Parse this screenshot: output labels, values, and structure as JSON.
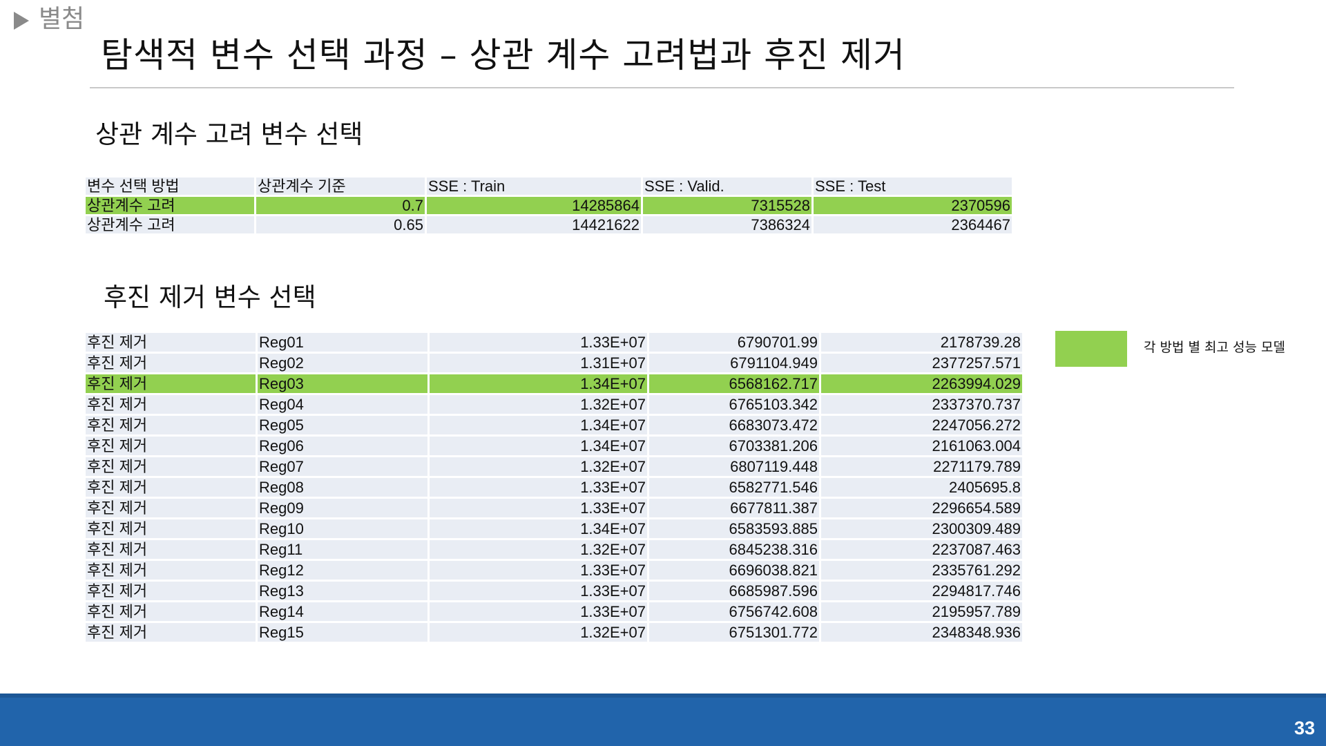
{
  "header": {
    "tag": "별첨",
    "title": "탐색적 변수 선택 과정 – 상관 계수 고려법과 후진 제거"
  },
  "section1": {
    "title": "상관 계수 고려 변수 선택",
    "columns": [
      "변수 선택 방법",
      "상관계수 기준",
      "SSE : Train",
      "SSE : Valid.",
      "SSE : Test"
    ],
    "rows": [
      {
        "method": "상관계수 고려",
        "threshold": "0.7",
        "train": "14285864",
        "valid": "7315528",
        "test": "2370596",
        "best": true
      },
      {
        "method": "상관계수 고려",
        "threshold": "0.65",
        "train": "14421622",
        "valid": "7386324",
        "test": "2364467",
        "best": false
      }
    ]
  },
  "section2": {
    "title": "후진 제거 변수 선택",
    "rows": [
      {
        "method": "후진 제거",
        "model": "Reg01",
        "train": "1.33E+07",
        "valid": "6790701.99",
        "test": "2178739.28",
        "best": false
      },
      {
        "method": "후진 제거",
        "model": "Reg02",
        "train": "1.31E+07",
        "valid": "6791104.949",
        "test": "2377257.571",
        "best": false
      },
      {
        "method": "후진 제거",
        "model": "Reg03",
        "train": "1.34E+07",
        "valid": "6568162.717",
        "test": "2263994.029",
        "best": true
      },
      {
        "method": "후진 제거",
        "model": "Reg04",
        "train": "1.32E+07",
        "valid": "6765103.342",
        "test": "2337370.737",
        "best": false
      },
      {
        "method": "후진 제거",
        "model": "Reg05",
        "train": "1.34E+07",
        "valid": "6683073.472",
        "test": "2247056.272",
        "best": false
      },
      {
        "method": "후진 제거",
        "model": "Reg06",
        "train": "1.34E+07",
        "valid": "6703381.206",
        "test": "2161063.004",
        "best": false
      },
      {
        "method": "후진 제거",
        "model": "Reg07",
        "train": "1.32E+07",
        "valid": "6807119.448",
        "test": "2271179.789",
        "best": false
      },
      {
        "method": "후진 제거",
        "model": "Reg08",
        "train": "1.33E+07",
        "valid": "6582771.546",
        "test": "2405695.8",
        "best": false
      },
      {
        "method": "후진 제거",
        "model": "Reg09",
        "train": "1.33E+07",
        "valid": "6677811.387",
        "test": "2296654.589",
        "best": false
      },
      {
        "method": "후진 제거",
        "model": "Reg10",
        "train": "1.34E+07",
        "valid": "6583593.885",
        "test": "2300309.489",
        "best": false
      },
      {
        "method": "후진 제거",
        "model": "Reg11",
        "train": "1.32E+07",
        "valid": "6845238.316",
        "test": "2237087.463",
        "best": false
      },
      {
        "method": "후진 제거",
        "model": "Reg12",
        "train": "1.33E+07",
        "valid": "6696038.821",
        "test": "2335761.292",
        "best": false
      },
      {
        "method": "후진 제거",
        "model": "Reg13",
        "train": "1.33E+07",
        "valid": "6685987.596",
        "test": "2294817.746",
        "best": false
      },
      {
        "method": "후진 제거",
        "model": "Reg14",
        "train": "1.33E+07",
        "valid": "6756742.608",
        "test": "2195957.789",
        "best": false
      },
      {
        "method": "후진 제거",
        "model": "Reg15",
        "train": "1.32E+07",
        "valid": "6751301.772",
        "test": "2348348.936",
        "best": false
      }
    ]
  },
  "legend": {
    "label": "각 방법 별 최고 성능 모델",
    "color": "#92d050"
  },
  "footer": {
    "page_number": "33",
    "bar_color": "#2164ab"
  }
}
